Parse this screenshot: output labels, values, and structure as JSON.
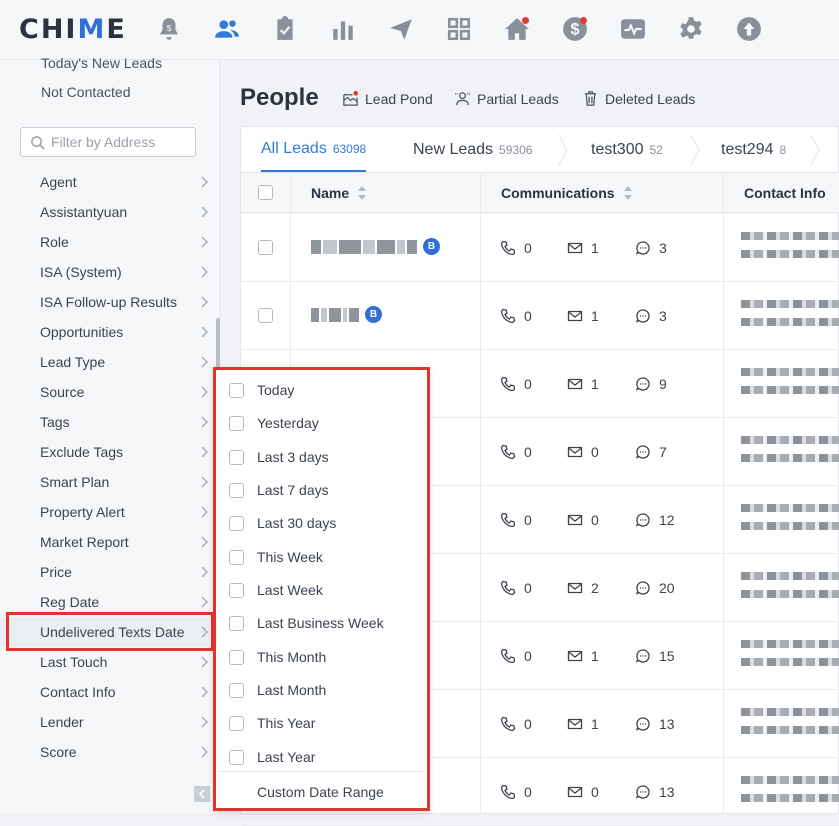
{
  "app": {
    "logo_left": "CHI",
    "logo_accent": "M",
    "logo_right": "E"
  },
  "nav_icons": [
    "bell-icon",
    "people-icon",
    "clipboard-icon",
    "bar-chart-icon",
    "send-icon",
    "dashboard-icon",
    "home-icon",
    "dollar-icon",
    "activity-icon",
    "gear-icon",
    "upload-icon"
  ],
  "sidebar": {
    "quick_filters": [
      "Today's New Leads",
      "Not Contacted"
    ],
    "filter_placeholder": "Filter by Address",
    "items": [
      {
        "label": "Agent"
      },
      {
        "label": "Assistantyuan"
      },
      {
        "label": "Role"
      },
      {
        "label": "ISA (System)"
      },
      {
        "label": "ISA Follow-up Results"
      },
      {
        "label": "Opportunities"
      },
      {
        "label": "Lead Type"
      },
      {
        "label": "Source"
      },
      {
        "label": "Tags"
      },
      {
        "label": "Exclude Tags"
      },
      {
        "label": "Smart Plan"
      },
      {
        "label": "Property Alert"
      },
      {
        "label": "Market Report"
      },
      {
        "label": "Price"
      },
      {
        "label": "Reg Date"
      },
      {
        "label": "Undelivered Texts Date"
      },
      {
        "label": "Last Touch"
      },
      {
        "label": "Contact Info"
      },
      {
        "label": "Lender"
      },
      {
        "label": "Score"
      }
    ],
    "active_item": "Undelivered Texts Date"
  },
  "header": {
    "title": "People",
    "links": {
      "lead_pond": "Lead Pond",
      "partial_leads": "Partial Leads",
      "deleted_leads": "Deleted Leads"
    }
  },
  "tabs": [
    {
      "label": "All Leads",
      "count": "63098"
    },
    {
      "label": "New Leads",
      "count": "59306"
    },
    {
      "label": "test300",
      "count": "52"
    },
    {
      "label": "test294",
      "count": "8"
    }
  ],
  "table": {
    "columns": {
      "name": "Name",
      "communications": "Communications",
      "contact_info": "Contact Info"
    },
    "rows": [
      {
        "calls": "0",
        "emails": "1",
        "texts": "3",
        "badge": "B"
      },
      {
        "calls": "0",
        "emails": "1",
        "texts": "3",
        "badge": "B"
      },
      {
        "calls": "0",
        "emails": "1",
        "texts": "9"
      },
      {
        "calls": "0",
        "emails": "0",
        "texts": "7"
      },
      {
        "calls": "0",
        "emails": "0",
        "texts": "12"
      },
      {
        "calls": "0",
        "emails": "2",
        "texts": "20"
      },
      {
        "calls": "0",
        "emails": "1",
        "texts": "15"
      },
      {
        "calls": "0",
        "emails": "1",
        "texts": "13"
      },
      {
        "calls": "0",
        "emails": "0",
        "texts": "13"
      }
    ]
  },
  "date_dropdown": {
    "options": [
      "Today",
      "Yesterday",
      "Last 3 days",
      "Last 7 days",
      "Last 30 days",
      "This Week",
      "Last Week",
      "Last Business Week",
      "This Month",
      "Last Month",
      "This Year",
      "Last Year"
    ],
    "custom": "Custom Date Range"
  },
  "colors": {
    "accent": "#2f7bd8",
    "highlight": "#e5322d",
    "notification_dot": "#e53935"
  }
}
